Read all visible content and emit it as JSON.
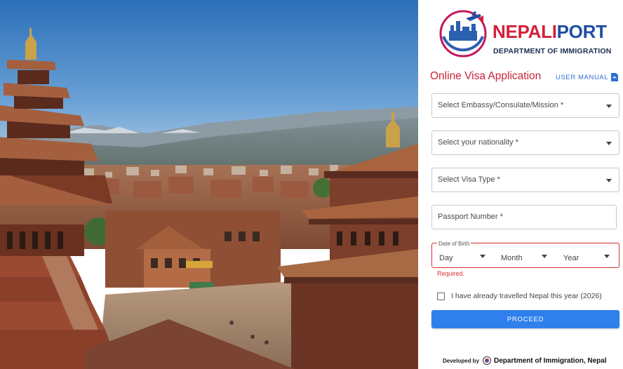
{
  "brand": {
    "title_part1": "NEPALI",
    "title_part2": "PORT",
    "subtitle": "DEPARTMENT OF IMMIGRATION"
  },
  "form": {
    "heading": "Online Visa Application",
    "user_manual": "USER MANUAL",
    "embassy_select": "Select Embassy/Consulate/Mission *",
    "nationality_select": "Select your nationality *",
    "visa_type_select": "Select Visa Type *",
    "passport_placeholder": "Passport Number *",
    "dob": {
      "legend": "Date of Birth",
      "day": "Day",
      "month": "Month",
      "year": "Year",
      "error": "Required."
    },
    "travelled_checkbox": "I have already travelled Nepal this year (2026)",
    "proceed_button": "PROCEED"
  },
  "footer": {
    "developed_by": "Developed by",
    "department": "Department of Immigration, Nepal"
  },
  "colors": {
    "accent_red": "#c8243a",
    "brand_blue": "#1f4ea3",
    "button_blue": "#2f80ed",
    "error_red": "#d32f2f"
  }
}
